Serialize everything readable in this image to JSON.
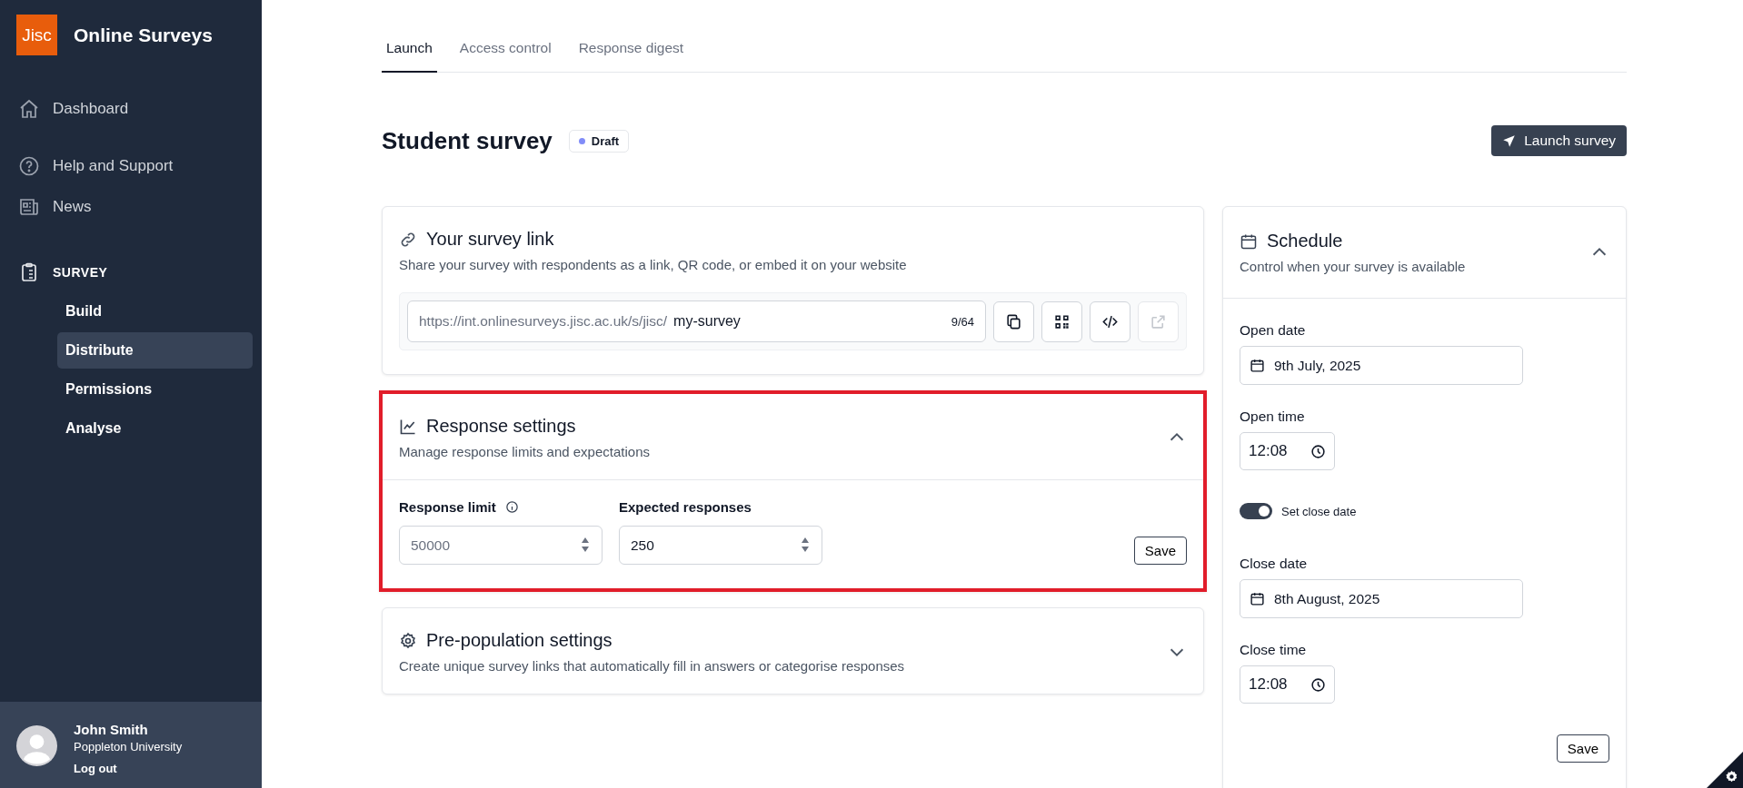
{
  "sidebar": {
    "logo": "Jisc",
    "app_name": "Online Surveys",
    "items": [
      {
        "label": "Dashboard"
      },
      {
        "label": "Help and Support"
      },
      {
        "label": "News"
      }
    ],
    "section": {
      "label": "SURVEY",
      "items": [
        {
          "label": "Build",
          "selected": false
        },
        {
          "label": "Distribute",
          "selected": true
        },
        {
          "label": "Permissions",
          "selected": false
        },
        {
          "label": "Analyse",
          "selected": false
        }
      ]
    },
    "user": {
      "name": "John Smith",
      "organisation": "Poppleton University",
      "logout": "Log out"
    }
  },
  "tabs": [
    {
      "label": "Launch",
      "selected": true
    },
    {
      "label": "Access control",
      "selected": false
    },
    {
      "label": "Response digest",
      "selected": false
    }
  ],
  "page": {
    "title": "Student survey",
    "status": "Draft",
    "action": "Launch survey"
  },
  "survey_link": {
    "title": "Your survey link",
    "description": "Share your survey with respondents as a link, QR code, or embed it on your website",
    "prefix": "https://int.onlinesurveys.jisc.ac.uk/s/jisc/",
    "value": "my-survey",
    "count": "9/64",
    "open_disabled": true
  },
  "response_settings": {
    "title": "Response settings",
    "description": "Manage response limits and expectations",
    "expanded": true,
    "highlighted": true,
    "fields": [
      {
        "label": "Response limit",
        "info": true,
        "placeholder": "50000"
      },
      {
        "label": "Expected responses",
        "info": false,
        "value": "250"
      }
    ],
    "save": "Save"
  },
  "prepopulation": {
    "title": "Pre-population settings",
    "description": "Create unique survey links that automatically fill in answers or categorise responses",
    "expanded": false
  },
  "schedule": {
    "title": "Schedule",
    "description": "Control when your survey is available",
    "expanded": true,
    "fields": [
      {
        "kind": "date",
        "label": "Open date",
        "value": "9th July, 2025"
      },
      {
        "kind": "time",
        "label": "Open time",
        "value": "12:08"
      },
      {
        "kind": "toggle",
        "label": "Set close date",
        "on": true
      },
      {
        "kind": "date",
        "label": "Close date",
        "value": "8th August, 2025"
      },
      {
        "kind": "time",
        "label": "Close time",
        "value": "12:08"
      }
    ],
    "save": "Save"
  }
}
